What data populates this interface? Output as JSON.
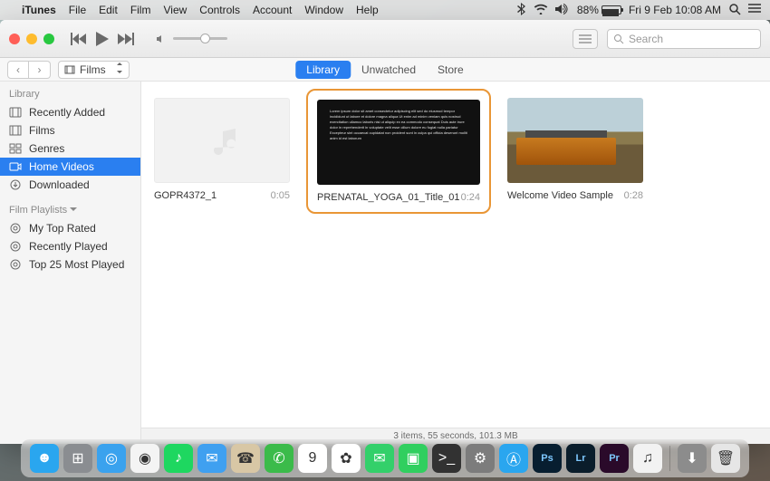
{
  "menubar": {
    "app": "iTunes",
    "items": [
      "File",
      "Edit",
      "Film",
      "View",
      "Controls",
      "Account",
      "Window",
      "Help"
    ],
    "battery_pct": "88%",
    "clock": "Fri 9 Feb  10:08 AM"
  },
  "toolbar": {
    "search_placeholder": "Search"
  },
  "subbar": {
    "source": "Films",
    "tabs": {
      "library": "Library",
      "unwatched": "Unwatched",
      "store": "Store",
      "active": "library"
    }
  },
  "sidebar": {
    "cat1": "Library",
    "items1": [
      {
        "label": "Recently Added",
        "icon": "clock"
      },
      {
        "label": "Films",
        "icon": "film"
      },
      {
        "label": "Genres",
        "icon": "grid"
      },
      {
        "label": "Home Videos",
        "icon": "camera",
        "selected": true
      },
      {
        "label": "Downloaded",
        "icon": "download"
      }
    ],
    "cat2": "Film Playlists",
    "items2": [
      {
        "label": "My Top Rated",
        "icon": "gear"
      },
      {
        "label": "Recently Played",
        "icon": "gear"
      },
      {
        "label": "Top 25 Most Played",
        "icon": "gear"
      }
    ]
  },
  "grid": {
    "items": [
      {
        "title": "GOPR4372_1",
        "duration": "0:05",
        "thumb": "blank"
      },
      {
        "title": "PRENATAL_YOGA_01_Title_01",
        "duration": "0:24",
        "thumb": "dark",
        "selected": true
      },
      {
        "title": "Welcome Video Sample",
        "duration": "0:28",
        "thumb": "train"
      }
    ]
  },
  "statusbar": {
    "text": "3 items, 55 seconds, 101.3 MB"
  },
  "dock": [
    {
      "name": "finder",
      "bg": "#2aa6ef"
    },
    {
      "name": "launchpad",
      "bg": "#8a8d91"
    },
    {
      "name": "safari",
      "bg": "#3aa2ee"
    },
    {
      "name": "chrome",
      "bg": "#f4f4f4"
    },
    {
      "name": "spotify",
      "bg": "#1ed760"
    },
    {
      "name": "mail",
      "bg": "#3fa0f0"
    },
    {
      "name": "contacts",
      "bg": "#d8c7a5"
    },
    {
      "name": "whatsapp",
      "bg": "#3bbb4a"
    },
    {
      "name": "calendar",
      "bg": "#ffffff"
    },
    {
      "name": "photos",
      "bg": "#ffffff"
    },
    {
      "name": "messages",
      "bg": "#33d06a"
    },
    {
      "name": "facetime",
      "bg": "#30cf5f"
    },
    {
      "name": "terminal",
      "bg": "#323232"
    },
    {
      "name": "systemprefs",
      "bg": "#7c7c7c"
    },
    {
      "name": "appstore",
      "bg": "#2aa6ef"
    },
    {
      "name": "photoshop",
      "bg": "#071e30"
    },
    {
      "name": "lightroom",
      "bg": "#0a1d2b"
    },
    {
      "name": "premiere",
      "bg": "#2a0a2a"
    },
    {
      "name": "itunes",
      "bg": "#f2f2f2"
    },
    {
      "name": "sep"
    },
    {
      "name": "downloads",
      "bg": "#8c8c8c"
    },
    {
      "name": "trash",
      "bg": "#e6e6e6"
    }
  ]
}
